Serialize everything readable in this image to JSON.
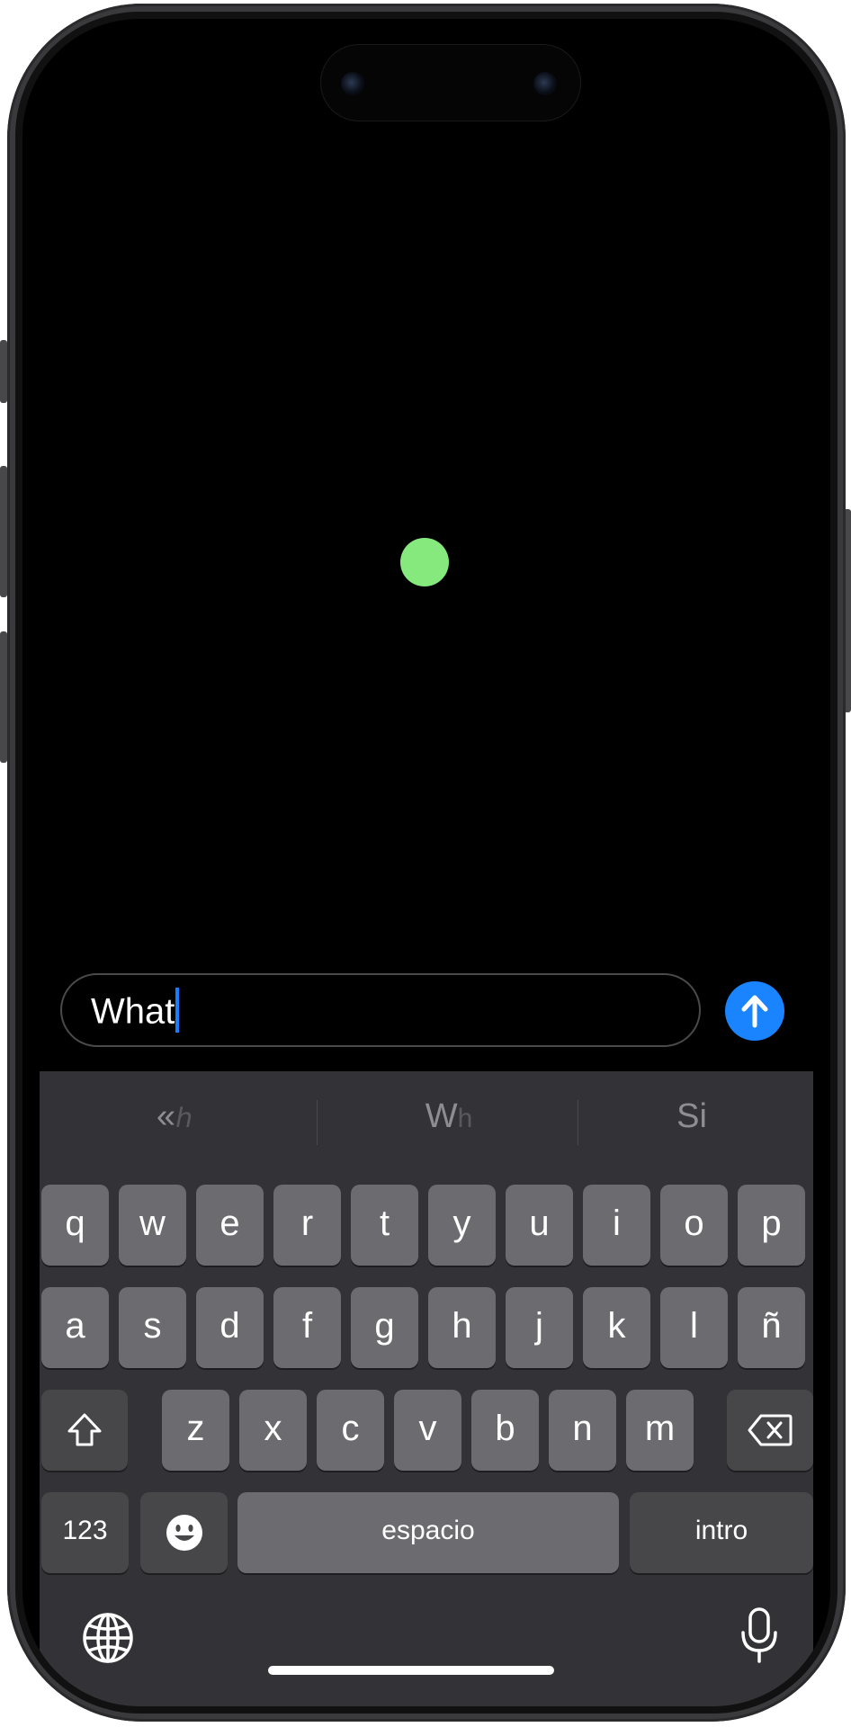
{
  "message_input": {
    "value": "What"
  },
  "keyboard": {
    "predictions": [
      "«",
      "W",
      "Si"
    ],
    "prediction_faint": [
      "ℎ",
      "h",
      ""
    ],
    "row1": [
      "q",
      "w",
      "e",
      "r",
      "t",
      "y",
      "u",
      "i",
      "o",
      "p"
    ],
    "row2": [
      "a",
      "s",
      "d",
      "f",
      "g",
      "h",
      "j",
      "k",
      "l",
      "ñ"
    ],
    "row3": [
      "z",
      "x",
      "c",
      "v",
      "b",
      "n",
      "m"
    ],
    "numbers_label": "123",
    "space_label": "espacio",
    "return_label": "intro"
  },
  "icons": {
    "send": "arrow-up-icon",
    "shift": "shift-icon",
    "delete": "backspace-icon",
    "emoji": "emoji-icon",
    "globe": "globe-icon",
    "mic": "microphone-icon"
  },
  "colors": {
    "status_dot": "#86e97e",
    "send_button": "#1a84ff",
    "caret": "#1a7cff"
  }
}
